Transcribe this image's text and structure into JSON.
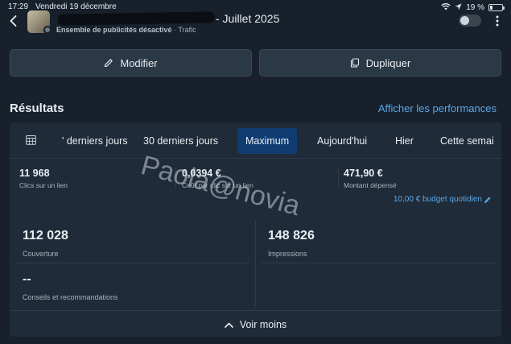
{
  "status_bar": {
    "time": "17:29",
    "date": "Vendredi 19 décembre",
    "battery": "19 %",
    "battery_level": 0.19
  },
  "header": {
    "title": "- Juillet 2025",
    "status": "Ensemble de publicités désactivé",
    "separator": "·",
    "objective": "Trafic"
  },
  "actions": {
    "edit_label": "Modifier",
    "duplicate_label": "Dupliquer"
  },
  "results": {
    "title": "Résultats",
    "performance_link": "Afficher les performances"
  },
  "tabs": [
    {
      "label": "' derniers jours"
    },
    {
      "label": "30 derniers jours"
    },
    {
      "label": "Maximum",
      "active": true
    },
    {
      "label": "Aujourd'hui"
    },
    {
      "label": "Hier"
    },
    {
      "label": "Cette semai"
    }
  ],
  "metrics": [
    {
      "value": "11 968",
      "label": "Clics sur un lien"
    },
    {
      "value": "0,0394 €",
      "label": "Coût par clic sur un lien"
    },
    {
      "value": "471,90 €",
      "label": "Montant dépensé"
    }
  ],
  "budget": "10,00 € budget quotidien",
  "summary": {
    "reach_value": "112 028",
    "reach_label": "Couverture",
    "impressions_value": "148 826",
    "impressions_label": "Impressions",
    "tips_value": "--",
    "tips_label": "Conseils et recommandations"
  },
  "see_less": "Voir moins",
  "watermark": "Paola@novia",
  "colors": {
    "background": "#17202b",
    "card": "#1f2b38",
    "accent_link": "#5aa7e8",
    "active_tab": "#0f3d72"
  }
}
